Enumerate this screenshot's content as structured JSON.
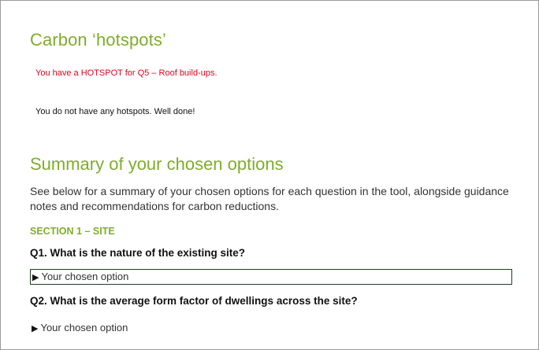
{
  "hotspots": {
    "title": "Carbon ‘hotspots’",
    "alert": "You have a HOTSPOT for Q5 – Roof build-ups.",
    "none": "You do not have any hotspots. Well done!"
  },
  "summary": {
    "title": "Summary of your chosen options",
    "intro": "See below for a summary of your chosen options for each question in the tool, alongside guidance notes and recommendations for carbon reductions."
  },
  "section1": {
    "label": "SECTION 1 – SITE",
    "questions": [
      {
        "text": "Q1. What is the nature of the existing site?",
        "option_label": "Your chosen option"
      },
      {
        "text": "Q2. What is the average form factor of dwellings across the site?",
        "option_label": "Your chosen option"
      }
    ]
  },
  "icons": {
    "expand": "triangle-right-icon",
    "expand_glyph": "▶"
  },
  "colors": {
    "accent_green": "#7fad2a",
    "alert_red": "#e3001b",
    "focus_border": "#1e4020"
  }
}
